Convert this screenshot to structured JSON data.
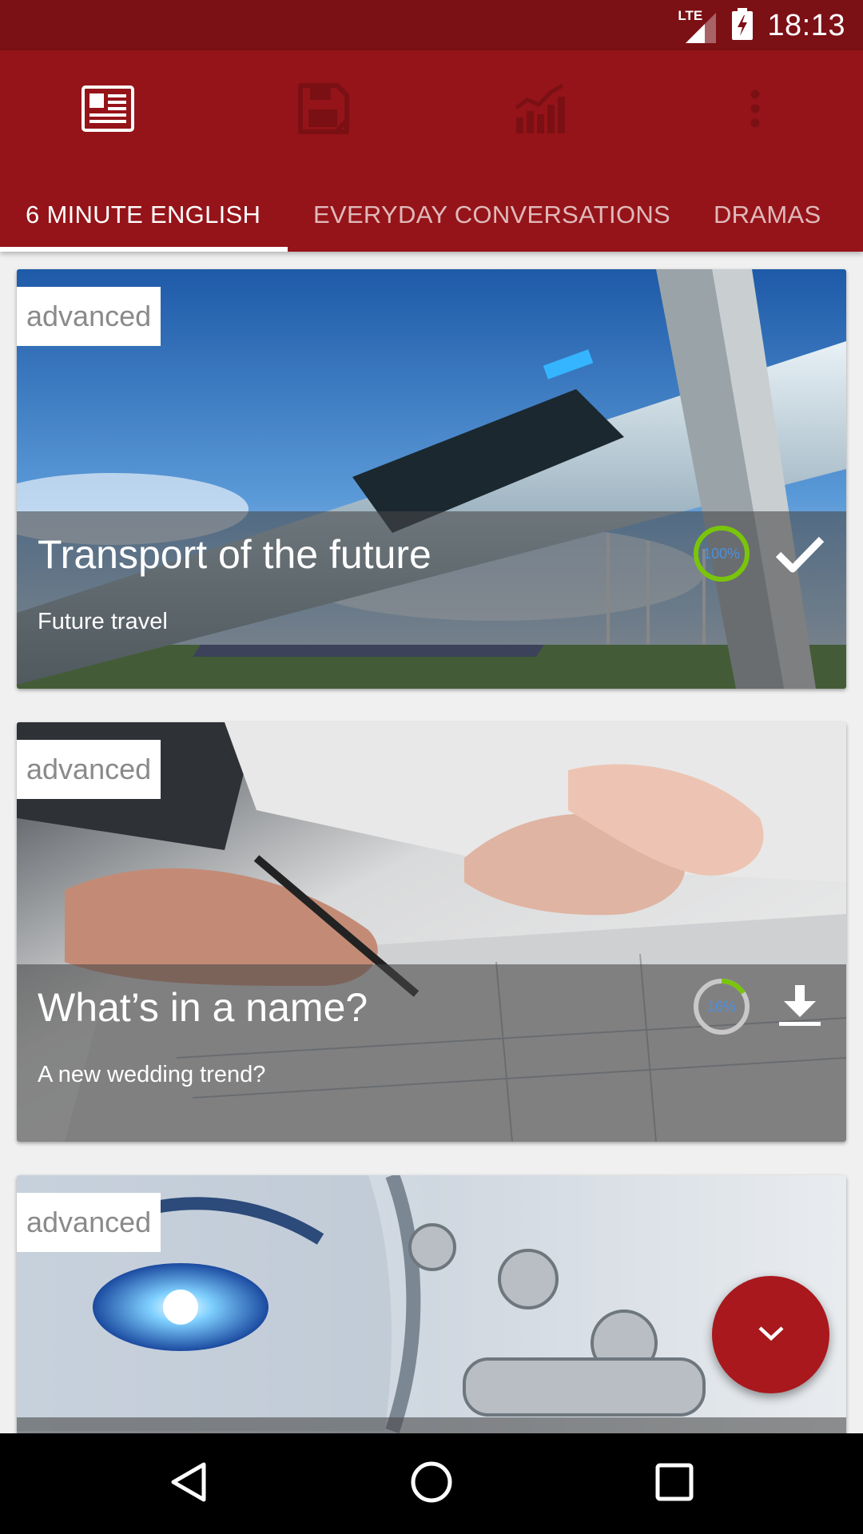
{
  "status_bar": {
    "time": "18:13",
    "network": "LTE"
  },
  "toolbar": {
    "icons": [
      "news-icon",
      "save-icon",
      "stats-icon",
      "more-icon"
    ]
  },
  "tabs": [
    {
      "label": "6 MINUTE ENGLISH",
      "active": true
    },
    {
      "label": "EVERYDAY CONVERSATIONS",
      "active": false
    },
    {
      "label": "DRAMAS",
      "active": false
    }
  ],
  "cards": [
    {
      "level": "advanced",
      "title": "Transport of the future",
      "subtitle": "Future travel",
      "progress_label": "100%",
      "progress": 1.0,
      "action": "completed-check-icon"
    },
    {
      "level": "advanced",
      "title": "What’s in a name?",
      "subtitle": "A new wedding trend?",
      "progress_label": "16%",
      "progress": 0.16,
      "action": "download-icon"
    },
    {
      "level": "advanced",
      "title": "",
      "subtitle": "",
      "progress_label": "",
      "progress": null,
      "action": ""
    }
  ],
  "colors": {
    "status_bar": "#7b1015",
    "app_bar": "#951419",
    "fab": "#a8181d",
    "progress_green": "#7ac50b",
    "progress_gray": "#c8c8c8",
    "progress_text": "#4a90e2"
  }
}
